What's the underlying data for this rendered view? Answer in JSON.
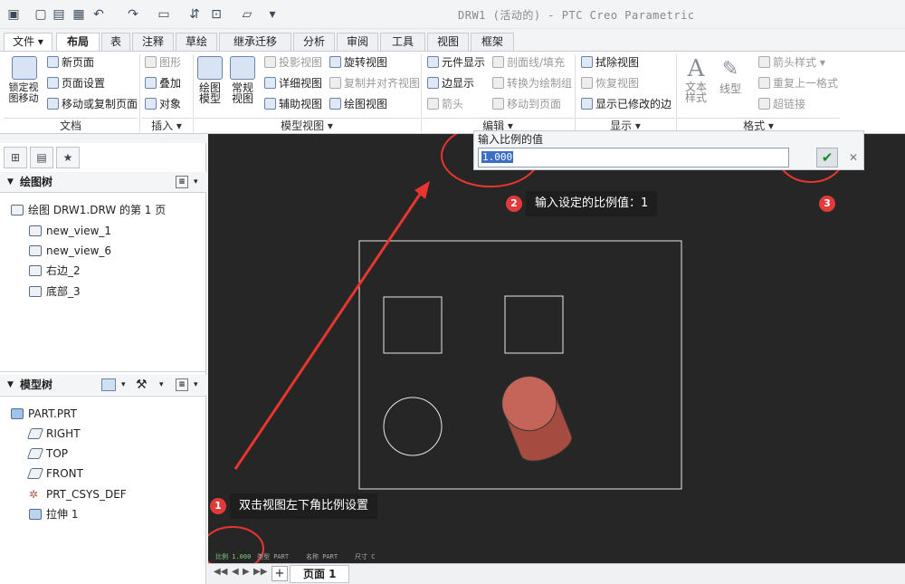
{
  "window": {
    "title": "DRW1 (活动的) - PTC Creo Parametric"
  },
  "quick_access": {
    "icons": [
      "app-icon",
      "new-icon",
      "open-icon",
      "save-icon",
      "undo-icon",
      "redo-icon",
      "window-icon",
      "regen-icon",
      "switch-icon",
      "folder-icon",
      "customize-icon"
    ]
  },
  "tabs": [
    {
      "label": "文件",
      "active": false
    },
    {
      "label": "布局",
      "active": true
    },
    {
      "label": "表",
      "active": false
    },
    {
      "label": "注释",
      "active": false
    },
    {
      "label": "草绘",
      "active": false
    },
    {
      "label": "继承迁移",
      "active": false
    },
    {
      "label": "分析",
      "active": false
    },
    {
      "label": "审阅",
      "active": false
    },
    {
      "label": "工具",
      "active": false
    },
    {
      "label": "视图",
      "active": false
    },
    {
      "label": "框架",
      "active": false
    }
  ],
  "ribbon": {
    "lock_view": "锁定视图移动",
    "new_page": "新页面",
    "page_setup": "页面设置",
    "move_copy_page": "移动或复制页面",
    "group_document": "文档",
    "graphic": "图形",
    "overlay": "叠加",
    "object": "对象",
    "group_insert": "插入",
    "drawing_model": "绘图模型",
    "general_view": "常规视图",
    "projection_view": "投影视图",
    "detail_view": "详细视图",
    "auxiliary_view": "辅助视图",
    "revolve_view": "旋转视图",
    "copy_align_view": "复制并对齐视图",
    "drawing_view": "绘图视图",
    "group_model_views": "模型视图",
    "element_display": "元件显示",
    "edge_display": "边显示",
    "arrow": "箭头",
    "section_line": "剖面线/填充",
    "convert_draft": "转换为绘制组",
    "move_to_page": "移动到页面",
    "group_edit": "编辑",
    "erase_view": "拭除视图",
    "restore_view": "恢复视图",
    "show_modified_edges": "显示已修改的边",
    "group_display": "显示",
    "text_style": "文本样式",
    "line_style": "线型",
    "arrow_style": "箭头样式",
    "repeat_format": "重复上一格式",
    "hyperlink": "超链接",
    "group_format": "格式"
  },
  "left_panel": {
    "drawing_tree_title": "绘图树",
    "drawing_tree": [
      "绘图 DRW1.DRW 的第 1 页",
      "new_view_1",
      "new_view_6",
      "右边_2",
      "底部_3"
    ],
    "model_tree_title": "模型树",
    "model_tree": [
      "PART.PRT",
      "RIGHT",
      "TOP",
      "FRONT",
      "PRT_CSYS_DEF",
      "拉伸 1"
    ]
  },
  "canvas": {
    "scale_text": "比例 1.000",
    "status_type": "类型 PART",
    "status_name": "名称 PART",
    "status_size": "尺寸 C"
  },
  "dialog": {
    "title": "输入比例的值",
    "value": "1.000"
  },
  "callouts": {
    "step1": "双击视图左下角比例设置",
    "step2": "输入设定的比例值：1",
    "badge1": "1",
    "badge2": "2",
    "badge3": "3"
  },
  "bottom": {
    "page_label": "页面 1"
  },
  "colors": {
    "annotation_red": "#e8362f",
    "canvas_bg": "#262626",
    "cylinder": "#b5554a"
  }
}
